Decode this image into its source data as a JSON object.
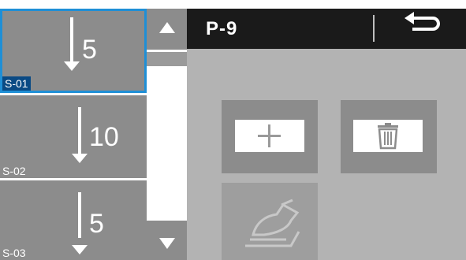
{
  "steps": [
    {
      "id": "S-01",
      "value": "5",
      "selected": true
    },
    {
      "id": "S-02",
      "value": "10",
      "selected": false
    },
    {
      "id": "S-03",
      "value": "5",
      "selected": false
    }
  ],
  "header": {
    "title": "P-9"
  },
  "icons": {
    "scroll_up": "triangle-up-icon",
    "scroll_down": "triangle-down-icon",
    "back": "return-arrow-icon",
    "add": "plus-icon",
    "delete": "trash-icon",
    "pedal": "foot-pedal-icon",
    "step_direction": "down-arrow-icon"
  },
  "colors": {
    "selection": "#1f8fd6",
    "selected_label_bg": "#0a4a84",
    "tile": "#8c8c8c",
    "header": "#1a1a1a",
    "panel": "#b3b3b3"
  }
}
